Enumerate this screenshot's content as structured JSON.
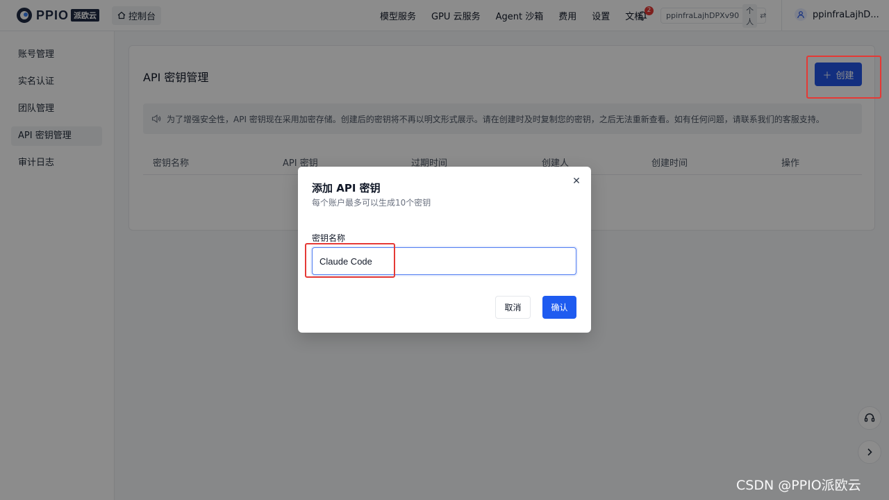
{
  "header": {
    "logo_text": "PPIO",
    "logo_sub": "派欧云",
    "console_label": "控制台",
    "nav": [
      "模型服务",
      "GPU 云服务",
      "Agent 沙箱",
      "费用",
      "设置",
      "文档"
    ],
    "notification_count": "2",
    "account_id": "ppinfraLajhDPXv90",
    "account_type": "个人",
    "username": "ppinfraLajhD..."
  },
  "sidebar": {
    "items": [
      {
        "label": "账号管理"
      },
      {
        "label": "实名认证"
      },
      {
        "label": "团队管理"
      },
      {
        "label": "API 密钥管理",
        "active": true
      },
      {
        "label": "审计日志"
      }
    ]
  },
  "main": {
    "title": "API 密钥管理",
    "create_label": "创建",
    "notice": "为了增强安全性，API 密钥现在采用加密存储。创建后的密钥将不再以明文形式展示。请在创建时及时复制您的密钥，之后无法重新查看。如有任何问题，请联系我们的客服支持。",
    "columns": [
      "密钥名称",
      "API 密钥",
      "过期时间",
      "创建人",
      "创建时间",
      "操作"
    ]
  },
  "modal": {
    "title": "添加 API 密钥",
    "subtitle": "每个账户最多可以生成10个密钥",
    "field_label": "密钥名称",
    "field_value": "Claude Code",
    "cancel_label": "取消",
    "confirm_label": "确认"
  },
  "watermark": "CSDN @PPIO派欧云",
  "colors": {
    "primary": "#1e5bf0",
    "highlight": "#e53935",
    "badge": "#e53935"
  },
  "icons": [
    "home-icon",
    "bell-icon",
    "swap-icon",
    "user-icon",
    "plus-icon",
    "speaker-icon",
    "close-icon",
    "headset-icon",
    "chevron-right-icon"
  ]
}
